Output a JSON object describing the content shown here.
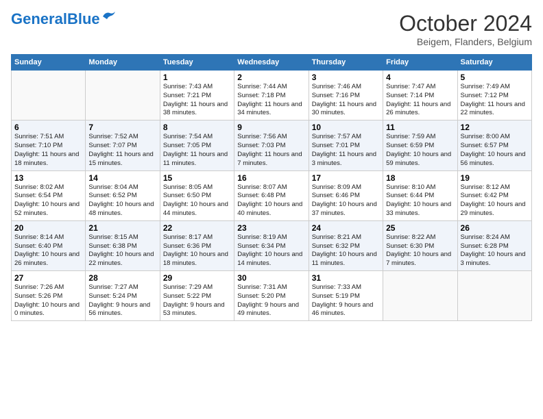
{
  "header": {
    "logo_general": "General",
    "logo_blue": "Blue",
    "month": "October 2024",
    "location": "Beigem, Flanders, Belgium"
  },
  "days_of_week": [
    "Sunday",
    "Monday",
    "Tuesday",
    "Wednesday",
    "Thursday",
    "Friday",
    "Saturday"
  ],
  "weeks": [
    [
      {
        "num": "",
        "info": ""
      },
      {
        "num": "",
        "info": ""
      },
      {
        "num": "1",
        "info": "Sunrise: 7:43 AM\nSunset: 7:21 PM\nDaylight: 11 hours\nand 38 minutes."
      },
      {
        "num": "2",
        "info": "Sunrise: 7:44 AM\nSunset: 7:18 PM\nDaylight: 11 hours\nand 34 minutes."
      },
      {
        "num": "3",
        "info": "Sunrise: 7:46 AM\nSunset: 7:16 PM\nDaylight: 11 hours\nand 30 minutes."
      },
      {
        "num": "4",
        "info": "Sunrise: 7:47 AM\nSunset: 7:14 PM\nDaylight: 11 hours\nand 26 minutes."
      },
      {
        "num": "5",
        "info": "Sunrise: 7:49 AM\nSunset: 7:12 PM\nDaylight: 11 hours\nand 22 minutes."
      }
    ],
    [
      {
        "num": "6",
        "info": "Sunrise: 7:51 AM\nSunset: 7:10 PM\nDaylight: 11 hours\nand 18 minutes."
      },
      {
        "num": "7",
        "info": "Sunrise: 7:52 AM\nSunset: 7:07 PM\nDaylight: 11 hours\nand 15 minutes."
      },
      {
        "num": "8",
        "info": "Sunrise: 7:54 AM\nSunset: 7:05 PM\nDaylight: 11 hours\nand 11 minutes."
      },
      {
        "num": "9",
        "info": "Sunrise: 7:56 AM\nSunset: 7:03 PM\nDaylight: 11 hours\nand 7 minutes."
      },
      {
        "num": "10",
        "info": "Sunrise: 7:57 AM\nSunset: 7:01 PM\nDaylight: 11 hours\nand 3 minutes."
      },
      {
        "num": "11",
        "info": "Sunrise: 7:59 AM\nSunset: 6:59 PM\nDaylight: 10 hours\nand 59 minutes."
      },
      {
        "num": "12",
        "info": "Sunrise: 8:00 AM\nSunset: 6:57 PM\nDaylight: 10 hours\nand 56 minutes."
      }
    ],
    [
      {
        "num": "13",
        "info": "Sunrise: 8:02 AM\nSunset: 6:54 PM\nDaylight: 10 hours\nand 52 minutes."
      },
      {
        "num": "14",
        "info": "Sunrise: 8:04 AM\nSunset: 6:52 PM\nDaylight: 10 hours\nand 48 minutes."
      },
      {
        "num": "15",
        "info": "Sunrise: 8:05 AM\nSunset: 6:50 PM\nDaylight: 10 hours\nand 44 minutes."
      },
      {
        "num": "16",
        "info": "Sunrise: 8:07 AM\nSunset: 6:48 PM\nDaylight: 10 hours\nand 40 minutes."
      },
      {
        "num": "17",
        "info": "Sunrise: 8:09 AM\nSunset: 6:46 PM\nDaylight: 10 hours\nand 37 minutes."
      },
      {
        "num": "18",
        "info": "Sunrise: 8:10 AM\nSunset: 6:44 PM\nDaylight: 10 hours\nand 33 minutes."
      },
      {
        "num": "19",
        "info": "Sunrise: 8:12 AM\nSunset: 6:42 PM\nDaylight: 10 hours\nand 29 minutes."
      }
    ],
    [
      {
        "num": "20",
        "info": "Sunrise: 8:14 AM\nSunset: 6:40 PM\nDaylight: 10 hours\nand 26 minutes."
      },
      {
        "num": "21",
        "info": "Sunrise: 8:15 AM\nSunset: 6:38 PM\nDaylight: 10 hours\nand 22 minutes."
      },
      {
        "num": "22",
        "info": "Sunrise: 8:17 AM\nSunset: 6:36 PM\nDaylight: 10 hours\nand 18 minutes."
      },
      {
        "num": "23",
        "info": "Sunrise: 8:19 AM\nSunset: 6:34 PM\nDaylight: 10 hours\nand 14 minutes."
      },
      {
        "num": "24",
        "info": "Sunrise: 8:21 AM\nSunset: 6:32 PM\nDaylight: 10 hours\nand 11 minutes."
      },
      {
        "num": "25",
        "info": "Sunrise: 8:22 AM\nSunset: 6:30 PM\nDaylight: 10 hours\nand 7 minutes."
      },
      {
        "num": "26",
        "info": "Sunrise: 8:24 AM\nSunset: 6:28 PM\nDaylight: 10 hours\nand 3 minutes."
      }
    ],
    [
      {
        "num": "27",
        "info": "Sunrise: 7:26 AM\nSunset: 5:26 PM\nDaylight: 10 hours\nand 0 minutes."
      },
      {
        "num": "28",
        "info": "Sunrise: 7:27 AM\nSunset: 5:24 PM\nDaylight: 9 hours\nand 56 minutes."
      },
      {
        "num": "29",
        "info": "Sunrise: 7:29 AM\nSunset: 5:22 PM\nDaylight: 9 hours\nand 53 minutes."
      },
      {
        "num": "30",
        "info": "Sunrise: 7:31 AM\nSunset: 5:20 PM\nDaylight: 9 hours\nand 49 minutes."
      },
      {
        "num": "31",
        "info": "Sunrise: 7:33 AM\nSunset: 5:19 PM\nDaylight: 9 hours\nand 46 minutes."
      },
      {
        "num": "",
        "info": ""
      },
      {
        "num": "",
        "info": ""
      }
    ]
  ]
}
